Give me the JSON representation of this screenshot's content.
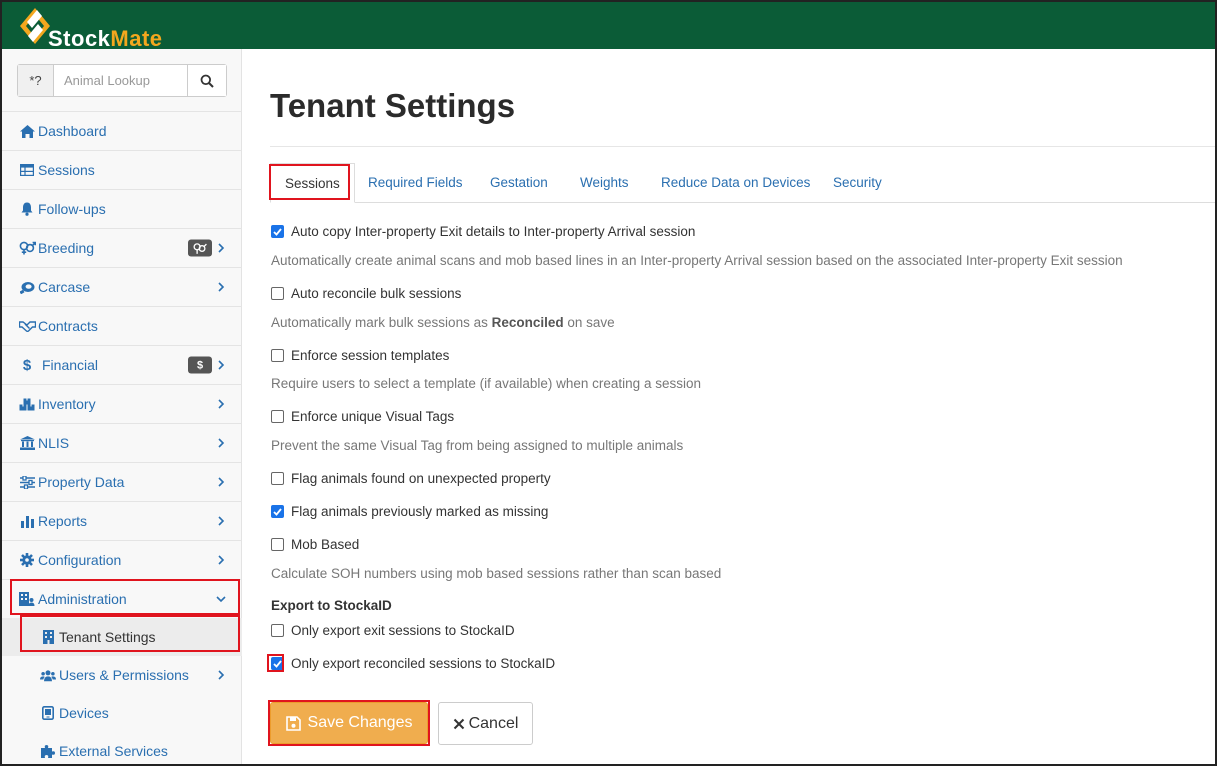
{
  "app": {
    "name_part1": "Stock",
    "name_part2": "Mate"
  },
  "search": {
    "prefix": "*?",
    "placeholder": "Animal Lookup"
  },
  "sidebar": {
    "items": [
      {
        "label": "Dashboard",
        "icon": "home-icon"
      },
      {
        "label": "Sessions",
        "icon": "table-icon"
      },
      {
        "label": "Follow-ups",
        "icon": "bell-icon"
      },
      {
        "label": "Breeding",
        "icon": "gender-icon",
        "badge_icon": "gender-icon"
      },
      {
        "label": "Carcase",
        "icon": "meat-icon"
      },
      {
        "label": "Contracts",
        "icon": "handshake-icon"
      },
      {
        "label": "Financial",
        "icon": "dollar-icon",
        "badge": "$"
      },
      {
        "label": "Inventory",
        "icon": "boxes-icon"
      },
      {
        "label": "NLIS",
        "icon": "bank-icon"
      },
      {
        "label": "Property Data",
        "icon": "sliders-icon"
      },
      {
        "label": "Reports",
        "icon": "bar-chart-icon"
      },
      {
        "label": "Configuration",
        "icon": "gear-icon"
      },
      {
        "label": "Administration",
        "icon": "building-user-icon",
        "expanded": true
      }
    ],
    "admin_sub_items": [
      {
        "label": "Tenant Settings",
        "icon": "building-icon",
        "active": true
      },
      {
        "label": "Users & Permissions",
        "icon": "users-icon"
      },
      {
        "label": "Devices",
        "icon": "tablet-icon"
      },
      {
        "label": "External Services",
        "icon": "puzzle-icon"
      }
    ]
  },
  "main": {
    "title": "Tenant Settings",
    "tabs": [
      "Sessions",
      "Required Fields",
      "Gestation",
      "Weights",
      "Reduce Data on Devices",
      "Security"
    ],
    "active_tab": "Sessions",
    "options": [
      {
        "label": "Auto copy Inter-property Exit details to Inter-property Arrival session",
        "checked": true,
        "help": "Automatically create animal scans and mob based lines in an Inter-property Arrival session based on the associated Inter-property Exit session"
      },
      {
        "label": "Auto reconcile bulk sessions",
        "checked": false,
        "help_before": "Automatically mark bulk sessions as ",
        "help_bold": "Reconciled",
        "help_after": " on save"
      },
      {
        "label": "Enforce session templates",
        "checked": false,
        "help": "Require users to select a template (if available) when creating a session"
      },
      {
        "label": "Enforce unique Visual Tags",
        "checked": false,
        "help": "Prevent the same Visual Tag from being assigned to multiple animals"
      },
      {
        "label": "Flag animals found on unexpected property",
        "checked": false
      },
      {
        "label": "Flag animals previously marked as missing",
        "checked": true
      },
      {
        "label": "Mob Based",
        "checked": false,
        "help": "Calculate SOH numbers using mob based sessions rather than scan based"
      }
    ],
    "export_section": {
      "title": "Export to StockaID",
      "options": [
        {
          "label": "Only export exit sessions to StockaID",
          "checked": false
        },
        {
          "label": "Only export reconciled sessions to StockaID",
          "checked": true
        }
      ]
    },
    "buttons": {
      "save": "Save Changes",
      "cancel": "Cancel"
    }
  },
  "colors": {
    "header": "#0b5c37",
    "accent": "#f3a71e",
    "link": "#2a6fb0",
    "save_button": "#f0ad4e",
    "highlight": "#e0141e",
    "checkbox": "#1a73e8"
  }
}
